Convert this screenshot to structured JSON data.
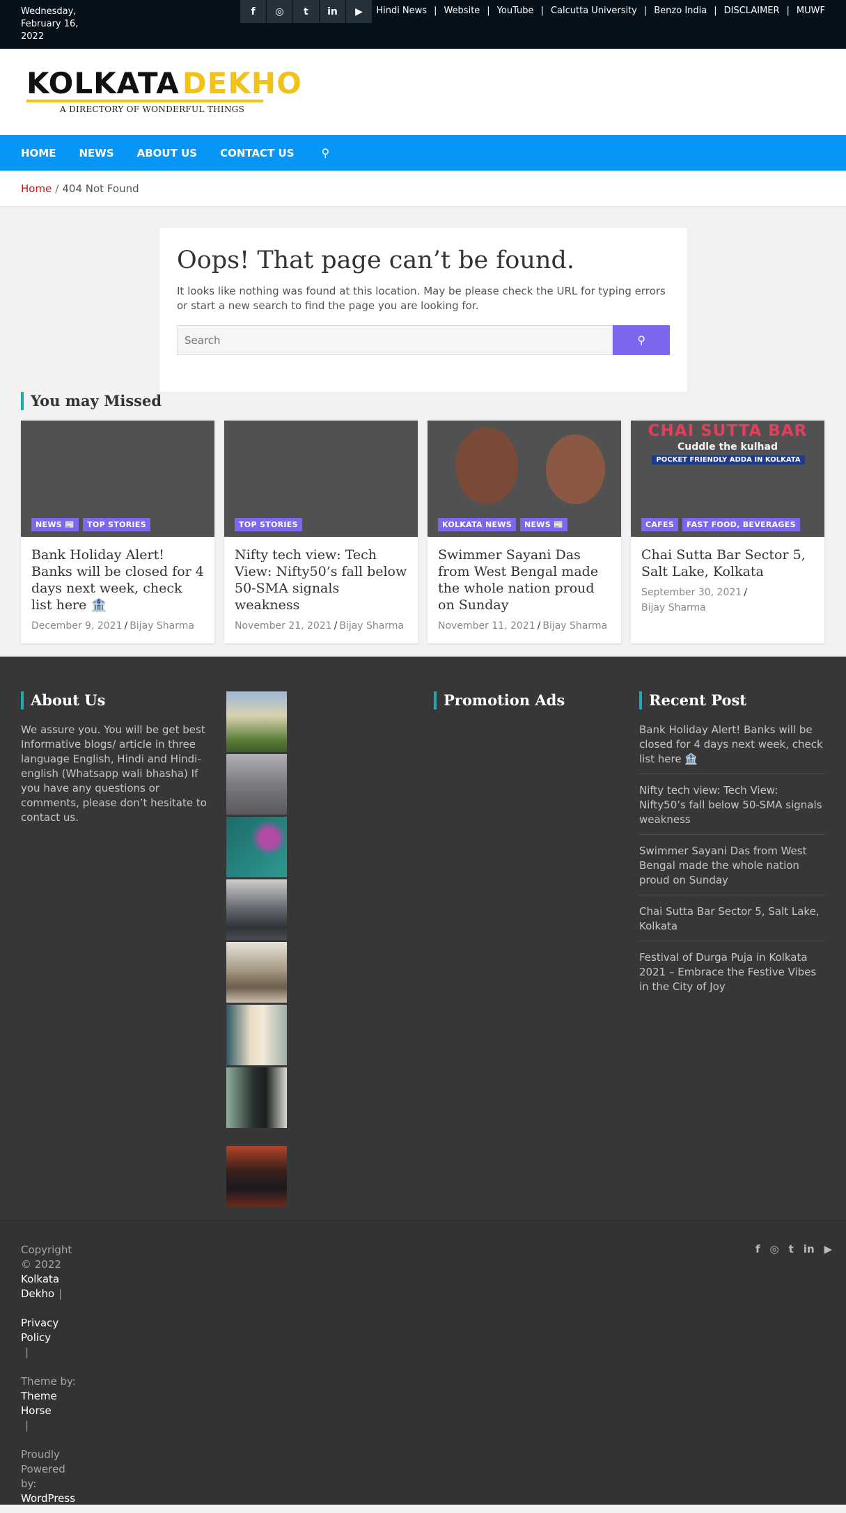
{
  "topbar": {
    "date": "Wednesday, February 16, 2022",
    "social_icons": [
      "facebook-icon",
      "instagram-icon",
      "twitter-icon",
      "linkedin-icon",
      "youtube-icon"
    ],
    "links": [
      "Hindi News",
      "Website",
      "YouTube",
      "Calcutta University",
      "Benzo India",
      "DISCLAIMER",
      "MUWF"
    ]
  },
  "logo": {
    "part1": "KOLKATA",
    "part2": "DEKHO",
    "tagline": "A DIRECTORY OF WONDERFUL THINGS"
  },
  "nav": {
    "items": [
      "HOME",
      "NEWS",
      "ABOUT US",
      "CONTACT US"
    ],
    "search_icon": "search-icon"
  },
  "breadcrumb": {
    "home": "Home",
    "separator": "/",
    "current": "404 Not Found"
  },
  "not_found": {
    "title": "Oops! That page can’t be found.",
    "message": "It looks like nothing was found at this location. May be please check the URL for typing errors or start a new search to find the page you are looking for.",
    "search_placeholder": "Search"
  },
  "missed": {
    "title": "You may Missed",
    "cards": [
      {
        "tags": [
          "NEWS 📰",
          "TOP STORIES"
        ],
        "title": "Bank Holiday Alert! Banks will be closed for 4 days next week, check list here 🏦",
        "date": "December 9, 2021",
        "author": "Bijay Sharma"
      },
      {
        "tags": [
          "TOP STORIES"
        ],
        "title": "Nifty tech view: Tech View: Nifty50’s fall below 50-SMA signals weakness",
        "date": "November 21, 2021",
        "author": "Bijay Sharma"
      },
      {
        "tags": [
          "KOLKATA NEWS",
          "NEWS 📰"
        ],
        "title": "Swimmer Sayani Das from West Bengal made the whole nation proud on Sunday",
        "date": "November 11, 2021",
        "author": "Bijay Sharma"
      },
      {
        "tags": [
          "CAFES",
          "FAST FOOD, BEVERAGES"
        ],
        "title": "Chai Sutta Bar Sector 5, Salt Lake, Kolkata",
        "date": "September 30, 2021",
        "author": "Bijay Sharma",
        "image_text": [
          "CHAI SUTTA BAR",
          "Cuddle the kulhad",
          "POCKET FRIENDLY ADDA IN KOLKATA"
        ]
      }
    ]
  },
  "footer": {
    "about_title": "About Us",
    "about_text": "We assure you. You will be get best Informative blogs/ article in three language English, Hindi and Hindi-english (Whatsapp wali bhasha) If you have any questions or comments, please don’t hesitate to contact us.",
    "promo_title": "Promotion Ads",
    "recent_title": "Recent Post",
    "recent_posts": [
      "Bank Holiday Alert! Banks will be closed for 4 days next week, check list here 🏦",
      "Nifty tech view: Tech View: Nifty50’s fall below 50-SMA signals weakness",
      "Swimmer Sayani Das from West Bengal made the whole nation proud on Sunday",
      "Chai Sutta Bar Sector 5, Salt Lake, Kolkata",
      "Festival of Durga Puja in Kolkata 2021 – Embrace the Festive Vibes in the City of Joy"
    ],
    "thumb_colors": [
      "#8a9a6a",
      "#7f7f85",
      "#2a7a7a",
      "#5a5e66",
      "#9a8f80",
      "#c8b98e",
      "#4a4f4a",
      "#3a2a2a"
    ]
  },
  "bottom": {
    "copyright": "Copyright © 2022",
    "site": "Kolkata Dekho",
    "privacy": "Privacy Policy",
    "theme_by": "Theme by:",
    "theme": "Theme Horse",
    "powered": "Proudly Powered by:",
    "wordpress": "WordPress",
    "social_icons": [
      "facebook-icon",
      "instagram-icon",
      "twitter-icon",
      "linkedin-icon",
      "youtube-icon"
    ]
  },
  "colors": {
    "nav": "#0896f6",
    "accent": "#7b68ee",
    "section_bar": "#1fa7b3",
    "topbar": "#07111a",
    "footer": "#373737"
  }
}
